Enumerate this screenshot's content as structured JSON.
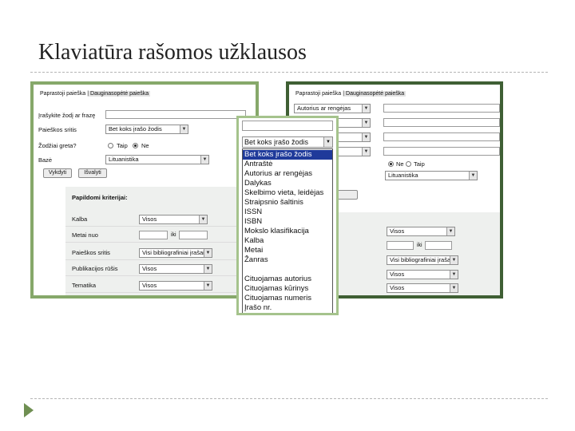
{
  "slide": {
    "title": "Klaviatūra rašomos užklausos"
  },
  "colors": {
    "light_frame": "#86a86a",
    "dark_frame": "#3f5f34",
    "dropdown_frame": "#a5c38c",
    "selection": "#1f3a9a",
    "nav_arrow": "#6f8f52"
  },
  "left_form": {
    "tab_active": "Paprastoji paieška",
    "tab_separator": "|",
    "tab_other": "Dauginasopėtė paieška",
    "query_label": "Įrašykite žodį ar frazę",
    "search_area_label": "Paieškos sritis",
    "search_area_value": "Bet koks įrašo žodis",
    "exact_label": "Žodžiai greta?",
    "radio_yes": "Taip",
    "radio_no": "Ne",
    "base_label": "Bazė",
    "base_value": "Lituanistika",
    "search_button": "Vykdyti",
    "clear_button": "Išvalyti",
    "criteria_heading": "Papildomi kriterijai:",
    "criteria": {
      "language_label": "Kalba",
      "language_value": "Visos",
      "years_label": "Metai nuo",
      "years_separator": "iki",
      "range_label": "Paieškos sritis",
      "range_value": "Visi bibliografiniai įrašai",
      "pubtype_label": "Publikacijos rūšis",
      "pubtype_value": "Visos",
      "subject_label": "Tematika",
      "subject_value": "Visos"
    }
  },
  "right_form": {
    "tab_active": "Paprastoji paieška",
    "tab_separator": "|",
    "tab_other": "Dauginasopėtė paieška",
    "field1_value": "Autorius ar rengėjas",
    "radio_yes": "Ne",
    "radio_no": "Taip",
    "base_value": "Lituanistika",
    "criteria": {
      "language_value": "Visos",
      "years_separator": "iki",
      "range_value": "Visi bibliografiniai įrašai",
      "pubtype_value": "Visos",
      "subject_value": "Visos"
    }
  },
  "dropdown": {
    "current_value": "Bet koks įrašo žodis",
    "items": [
      "Bet koks įrašo žodis",
      "Antraštė",
      "Autorius ar rengėjas",
      "Dalykas",
      "Skelbimo vieta, leidėjas",
      "Straipsnio šaltinis",
      "ISSN",
      "ISBN",
      "Mokslo klasifikacija",
      "Kalba",
      "Metai",
      "Žanras",
      "Cituojamas autorius",
      "Cituojamas kūrinys",
      "Cituojamas numeris",
      "Įrašo nr."
    ],
    "selected_index": 0
  }
}
